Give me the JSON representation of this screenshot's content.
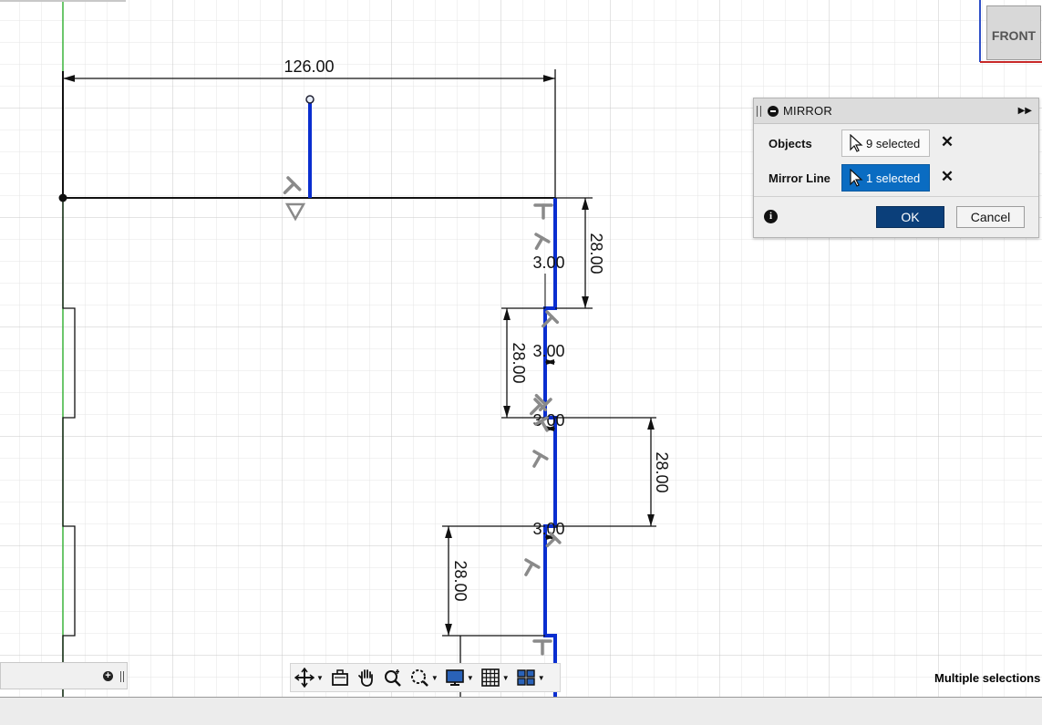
{
  "viewcube": {
    "face_label": "FRONT"
  },
  "sketch": {
    "dimensions": [
      {
        "label": "126.00"
      },
      {
        "label": "28.00"
      },
      {
        "label": "3.00"
      },
      {
        "label": "28.00"
      },
      {
        "label": "3.00"
      },
      {
        "label": "3.00"
      },
      {
        "label": "28.00"
      },
      {
        "label": "3.00"
      },
      {
        "label": "28.00"
      }
    ]
  },
  "mirror_dialog": {
    "title": "MIRROR",
    "objects_label": "Objects",
    "objects_value": "9 selected",
    "mirror_line_label": "Mirror Line",
    "mirror_line_value": "1 selected",
    "ok_label": "OK",
    "cancel_label": "Cancel"
  },
  "nav_toolbar": {
    "icons": [
      "orbit-icon",
      "look-at-icon",
      "pan-icon",
      "zoom-icon",
      "fit-icon",
      "display-icon",
      "grid-icon",
      "viewports-icon"
    ]
  },
  "status": {
    "selection_text": "Multiple selections"
  },
  "colors": {
    "sketch_line": "#0a2ed0",
    "dialog_active": "#0a6cc2",
    "ok_button": "#0b3f7a",
    "axis_green": "#3cb43c"
  }
}
